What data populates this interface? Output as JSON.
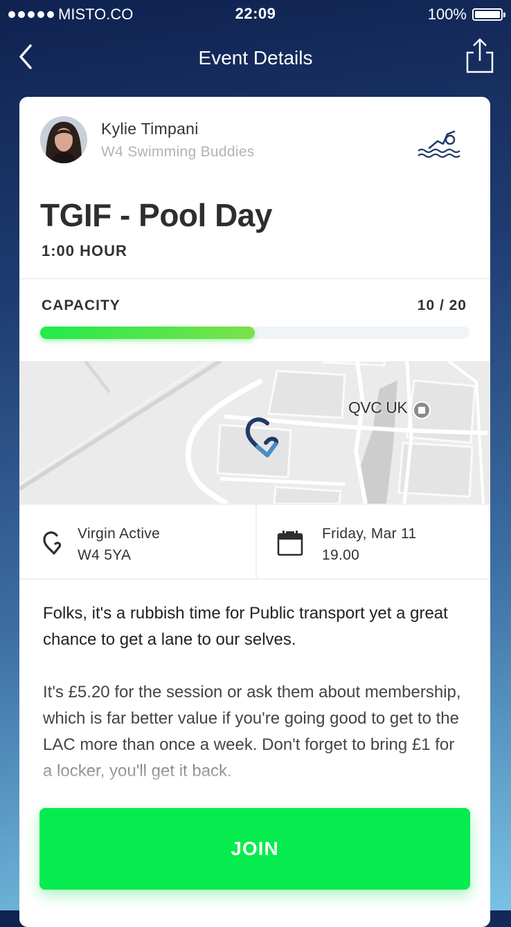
{
  "status_bar": {
    "carrier": "MISTO.CO",
    "time": "22:09",
    "battery": "100%"
  },
  "nav": {
    "title": "Event Details"
  },
  "organizer": {
    "name": "Kylie Timpani",
    "group": "W4 Swimming Buddies"
  },
  "event": {
    "title": "TGIF - Pool Day",
    "duration": "1:00 HOUR"
  },
  "capacity": {
    "label": "CAPACITY",
    "count_text": "10 / 20",
    "filled": 10,
    "total": 20
  },
  "map": {
    "poi_label": "QVC UK"
  },
  "location": {
    "name": "Virgin Active",
    "postcode": "W4 5YA"
  },
  "datetime": {
    "date": "Friday, Mar 11",
    "time": "19.00"
  },
  "description": {
    "paragraph1": "Folks, it's a rubbish time for Public transport yet a great chance to get a lane to our selves.",
    "paragraph2": "It's £5.20 for the session or ask them about membership, which is far better value if you're going good to get to the LAC more than once a week.  Don't forget to bring £1 for a locker, you'll get it back."
  },
  "actions": {
    "join_label": "JOIN"
  },
  "colors": {
    "accent_green": "#06ec4e",
    "progress_start": "#22ea4a",
    "progress_end": "#7de14c",
    "icon_blue": "#1f3a66"
  },
  "icons": {
    "back": "chevron-left-icon",
    "share": "share-icon",
    "activity": "swimming-icon",
    "location": "location-pin-icon",
    "calendar": "calendar-icon"
  }
}
